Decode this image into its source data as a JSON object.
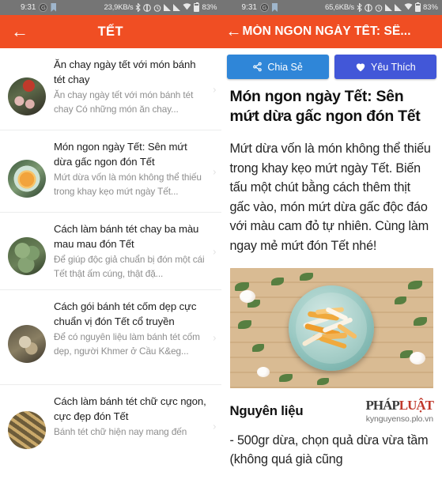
{
  "left": {
    "statusbar": {
      "time": "9:31",
      "g_badge": "G",
      "bookmark_icon": "bookmark-icon",
      "data_speed": "23,9KB/s",
      "bluetooth_icon": "bluetooth-icon",
      "vibrate_icon": "vibrate-icon",
      "alarm_icon": "alarm-icon",
      "signal_icon": "signal-bars-icon",
      "wifi_icon": "wifi-icon",
      "battery_icon": "battery-icon",
      "battery_level": "83%"
    },
    "appbar": {
      "back_icon": "back-arrow-icon",
      "title": "TẾT"
    },
    "items": [
      {
        "title": "Ăn chay ngày tết với món bánh tét chay",
        "subtitle": "Ăn chay ngày tết với món bánh tét chay   Có những món ăn chay...",
        "thumb_class": "th1",
        "chevron_icon": "chevron-right-icon"
      },
      {
        "title": "Món ngon ngày Tết: Sên mứt dừa gấc ngon đón Tết",
        "subtitle": "Mứt dừa vốn là món không thể thiếu trong khay kẹo mứt ngày Tết...",
        "thumb_class": "th2",
        "chevron_icon": "chevron-right-icon"
      },
      {
        "title": "Cách làm bánh tét chay ba màu mau mau đón Tết",
        "subtitle": "Để giúp độc giả chuẩn bị đón một cái Tết thật ấm cúng, thật đặ...",
        "thumb_class": "th3",
        "chevron_icon": "chevron-right-icon"
      },
      {
        "title": "Cách gói bánh tét cốm dẹp cực chuẩn vị đón Tết cổ truyền",
        "subtitle": "Để có nguyên liệu làm bánh tét cốm dẹp, người Khmer ở Cầu K&eg...",
        "thumb_class": "th4",
        "chevron_icon": "chevron-right-icon"
      },
      {
        "title": "Cách làm bánh tét chữ cực ngon, cực đẹp đón Tết",
        "subtitle": "Bánh tét chữ hiện nay mang đến",
        "thumb_class": "th5",
        "chevron_icon": "chevron-right-icon"
      }
    ]
  },
  "right": {
    "statusbar": {
      "time": "9:31",
      "g_badge": "G",
      "bookmark_icon": "bookmark-icon",
      "data_speed": "65,6KB/s",
      "bluetooth_icon": "bluetooth-icon",
      "vibrate_icon": "vibrate-icon",
      "alarm_icon": "alarm-icon",
      "signal_icon": "signal-bars-icon",
      "wifi_icon": "wifi-icon",
      "battery_icon": "battery-icon",
      "battery_level": "83%"
    },
    "appbar": {
      "back_icon": "back-arrow-icon",
      "title": "MÓN NGON NGÀY TẾT: SÊ..."
    },
    "actions": {
      "share_label": "Chia Sẻ",
      "share_icon": "share-icon",
      "fav_label": "Yêu Thích",
      "fav_icon": "heart-icon"
    },
    "article": {
      "title": "Món ngon ngày Tết: Sên mứt dừa gấc ngon đón Tết",
      "paragraph": "Mứt dừa vốn là món không thể thiếu trong khay kẹo mứt ngày Tết. Biến tấu một chút bằng cách thêm thịt gấc vào, món mứt dừa gấc độc đáo với màu cam đỏ tự nhiên. Cùng làm ngay mẻ mứt đón Tết nhé!",
      "image_alt": "mut-dua-gac-bowl-photo",
      "section_heading": "Nguyên liệu",
      "watermark_logo_1": "PHÁP",
      "watermark_logo_2": "LUẬT",
      "watermark_url": "kynguyenso.plo.vn",
      "ingredient_line": "- 500gr dừa, chọn quả dừa vừa tầm (không quá già cũng"
    }
  },
  "colors": {
    "appbar": "#f04e23",
    "statusbar": "#757575",
    "share_button": "#2f86d8",
    "fav_button": "#4257d8",
    "title_text": "#111111",
    "subtitle_text": "#8e8e8e"
  }
}
